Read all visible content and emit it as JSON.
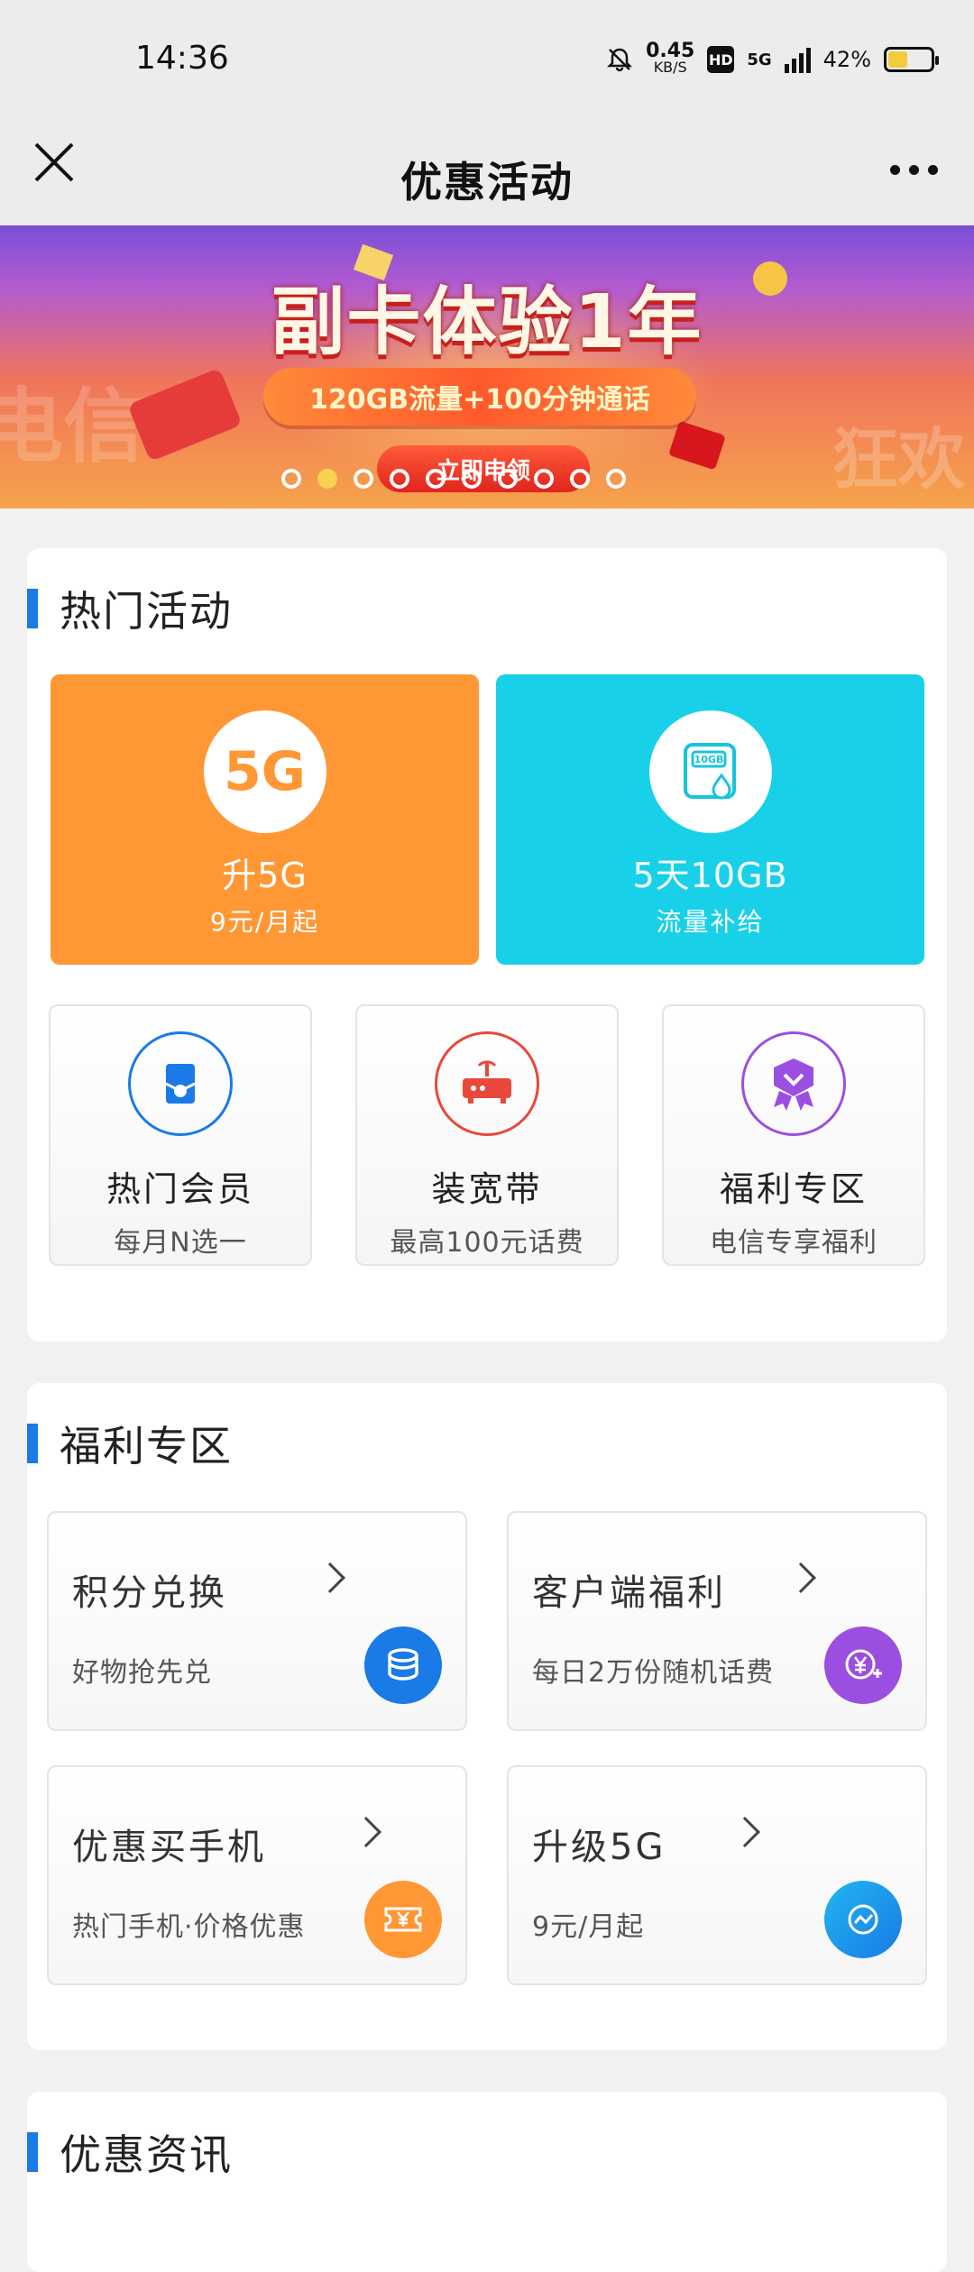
{
  "status_bar": {
    "time": "14:36",
    "net_speed_value": "0.45",
    "net_speed_unit": "KB/S",
    "hd_label": "HD",
    "network_label": "5G",
    "battery_text": "42%",
    "battery_level": 0.42
  },
  "nav": {
    "title": "优惠活动"
  },
  "banner": {
    "headline": "副卡体验1年",
    "subline": "120GB流量+100分钟通话",
    "cta": "立即申领",
    "bg_left_text": "电信",
    "bg_right_text": "狂欢",
    "card_text": "",
    "envelope_text": "",
    "dot_count": 10,
    "active_dot": 1
  },
  "hot_section": {
    "title": "热门活动",
    "big_cards": [
      {
        "icon_text": "5G",
        "line1": "升5G",
        "line2": "9元/月起"
      },
      {
        "icon_text": "10GB",
        "line1": "5天10GB",
        "line2": "流量补给"
      }
    ],
    "small_cards": [
      {
        "line1": "热门会员",
        "line2": "每月N选一"
      },
      {
        "line1": "装宽带",
        "line2": "最高100元话费"
      },
      {
        "line1": "福利专区",
        "line2": "电信专享福利"
      }
    ]
  },
  "welfare_section": {
    "title": "福利专区",
    "cards": [
      {
        "title": "积分兑换",
        "subtitle": "好物抢先兑"
      },
      {
        "title": "客户端福利",
        "subtitle": "每日2万份随机话费"
      },
      {
        "title": "优惠买手机",
        "subtitle": "热门手机·价格优惠"
      },
      {
        "title": "升级5G",
        "subtitle": "9元/月起"
      }
    ]
  },
  "news_section": {
    "title": "优惠资讯"
  },
  "colors": {
    "accent_blue": "#1a7ae6",
    "orange": "#ff9735",
    "cyan": "#18d0e8",
    "purple": "#9b4fe0"
  }
}
